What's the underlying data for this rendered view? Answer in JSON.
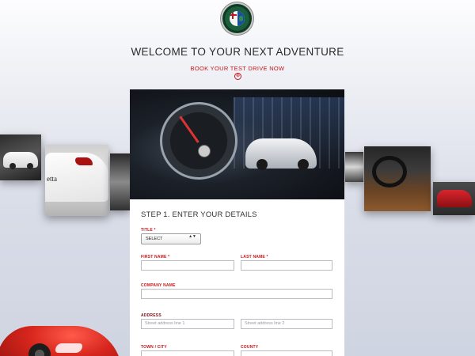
{
  "header": {
    "headline": "WELCOME TO YOUR NEXT ADVENTURE",
    "cta": "BOOK YOUR TEST DRIVE NOW",
    "cta_arrow": "⊕"
  },
  "carousel": {
    "left_panel_label": "etta"
  },
  "form": {
    "step_title": "STEP 1. ENTER YOUR DETAILS",
    "title_label": "TITLE *",
    "title_select": {
      "value": "SELECT",
      "arrows": "▲▼"
    },
    "first_name_label": "FIRST NAME *",
    "last_name_label": "LAST NAME *",
    "company_label": "COMPANY NAME",
    "address_label": "ADDRESS",
    "address_line1_placeholder": "Street address line 1",
    "address_line2_placeholder": "Street address line 2",
    "town_label": "TOWN /  CITY",
    "county_label": "COUNTY"
  },
  "colors": {
    "accent_red": "#c4161c",
    "text_dark": "#2a2a2a",
    "field_border": "#b9bcc3"
  }
}
